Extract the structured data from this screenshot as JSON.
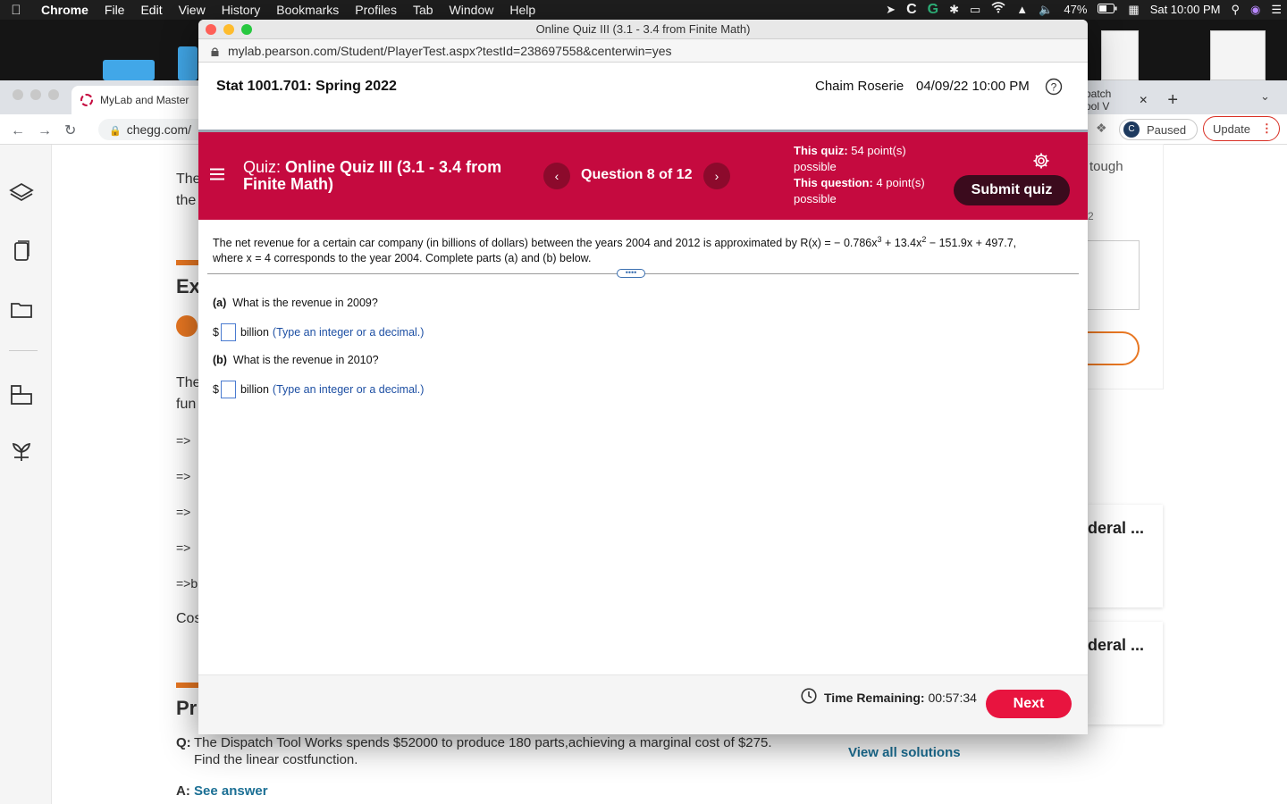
{
  "menubar": {
    "app": "Chrome",
    "items": [
      "File",
      "Edit",
      "View",
      "History",
      "Bookmarks",
      "Profiles",
      "Tab",
      "Window",
      "Help"
    ],
    "battery": "47%",
    "clock": "Sat 10:00 PM"
  },
  "bg_browser": {
    "tab1_label": "MyLab and Master",
    "tab2_label": "spatch Tool V",
    "url": "chegg.com/",
    "paused_label": "Paused",
    "avatar_letter": "C",
    "update_label": "Update",
    "snippets": {
      "the1": "The",
      "the2": "the",
      "ex": "Ex",
      "the3": "The",
      "fun": "fun",
      "arrows": [
        "=>",
        "=>",
        "=>",
        "=>",
        "=>b"
      ],
      "cos": "Cos",
      "pr": "Pr",
      "tough": "tough",
      "deral1": "deral ...",
      "deral2": "deral ...",
      "digit": "2"
    },
    "qa": {
      "q_label": "Q:",
      "q_text_line1": "The Dispatch Tool Works spends $52000 to produce 180 parts,achieving a marginal cost of $275.",
      "q_text_line2": "Find the linear costfunction.",
      "a_label": "A:",
      "see_answer": "See answer",
      "view_all": "View all solutions"
    }
  },
  "popup": {
    "window_title": "Online Quiz III (3.1 - 3.4 from Finite Math)",
    "url": "mylab.pearson.com/Student/PlayerTest.aspx?testId=238697558&centerwin=yes",
    "course": "Stat 1001.701: Spring 2022",
    "student": "Chaim Roserie",
    "datetime": "04/09/22 10:00 PM",
    "quiz_prefix": "Quiz:",
    "quiz_name": "Online Quiz III (3.1 - 3.4 from Finite Math)",
    "question_counter": "Question 8 of 12",
    "quiz_points_label": "This quiz:",
    "quiz_points_value": "54 point(s) possible",
    "question_points_label": "This question:",
    "question_points_value": "4 point(s) possible",
    "submit_label": "Submit quiz",
    "question_text_1": "The net revenue for a certain car company (in billions of dollars) between the years 2004 and 2012 is approximated by R(x) = − 0.786x",
    "question_text_2": " + 13.4x",
    "question_text_3": " − 151.9x + 497.7,",
    "question_text_4": "where x = 4 corresponds to the year 2004. Complete parts (a) and (b) below.",
    "exp3": "3",
    "exp2": "2",
    "handle": "••••",
    "part_a_label": "(a)",
    "part_a_text": "What is the revenue in 2009?",
    "part_b_label": "(b)",
    "part_b_text": "What is the revenue in 2010?",
    "currency": "$",
    "unit": "billion",
    "hint": "(Type an integer or a decimal.)",
    "timer_label": "Time Remaining:",
    "timer_value": "00:57:34",
    "next_label": "Next"
  }
}
